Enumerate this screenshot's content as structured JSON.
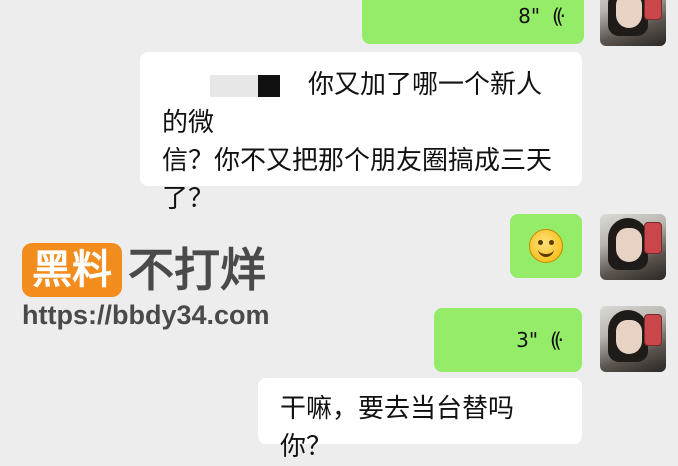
{
  "messages": [
    {
      "type": "voice",
      "side": "right",
      "duration": "8\"",
      "wave_icon": "voice-wave-icon"
    },
    {
      "type": "text",
      "side": "left",
      "lines": [
        "你又加了哪一个新人的微",
        "信？你不又把那个朋友圈搞成三天",
        "了？"
      ]
    },
    {
      "type": "emoji",
      "side": "right",
      "emoji": "smiling-face-emoji"
    },
    {
      "type": "voice",
      "side": "right",
      "duration": "3\"",
      "wave_icon": "voice-wave-icon"
    },
    {
      "type": "text",
      "side": "left",
      "lines": [
        "干嘛，要去当台替吗你？"
      ]
    }
  ],
  "watermark": {
    "badge": "黑料",
    "main": "不打烊",
    "url": "https://bbdy34.com"
  },
  "colors": {
    "background": "#ededed",
    "right_bubble": "#95ec69",
    "left_bubble": "#ffffff",
    "watermark_orange": "#f28c1d"
  }
}
